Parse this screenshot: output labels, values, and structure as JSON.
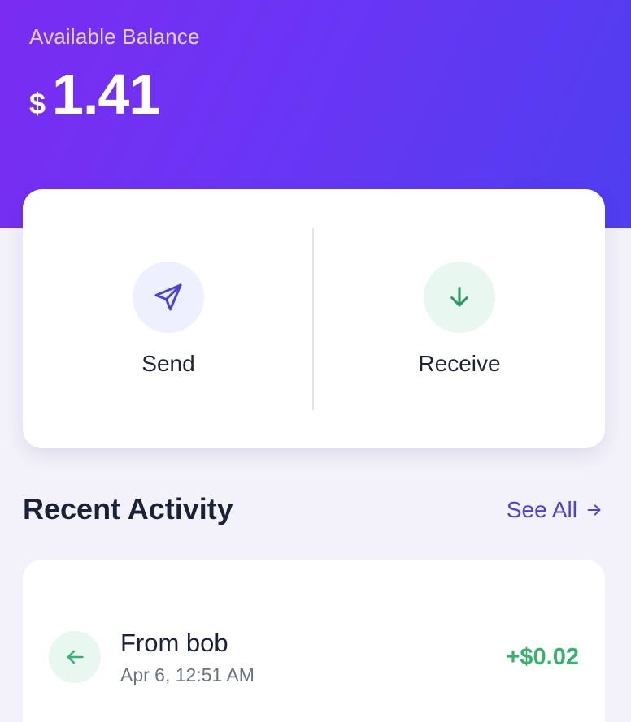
{
  "balance": {
    "label": "Available Balance",
    "currency_symbol": "$",
    "amount": "1.41"
  },
  "actions": {
    "send": {
      "label": "Send",
      "icon": "send-icon"
    },
    "receive": {
      "label": "Receive",
      "icon": "arrow-down-icon"
    }
  },
  "activity": {
    "title": "Recent Activity",
    "see_all_label": "See All",
    "see_all_icon": "arrow-right-icon",
    "transactions": [
      {
        "title": "From bob",
        "time": "Apr 6, 12:51 AM",
        "amount": "+$0.02",
        "direction_icon": "arrow-left-icon"
      }
    ]
  },
  "colors": {
    "accent": "#4c3fe0",
    "positive": "#34b36e",
    "hero_gradient_start": "#7a2cf2",
    "hero_gradient_end": "#4f3ef0"
  }
}
